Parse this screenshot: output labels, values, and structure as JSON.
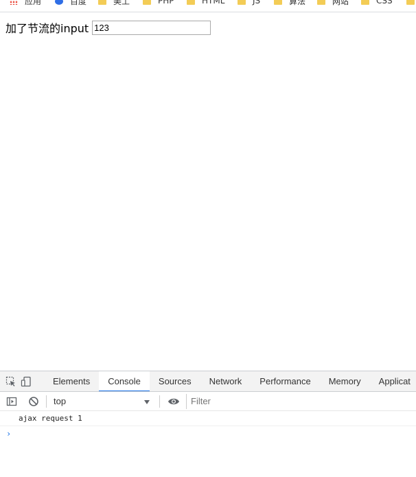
{
  "bookmarks": [
    {
      "label": "应用",
      "icon": "apps-icon"
    },
    {
      "label": "百度",
      "icon": "baidu-icon"
    },
    {
      "label": "美工",
      "icon": "folder-icon"
    },
    {
      "label": "PHP",
      "icon": "folder-icon"
    },
    {
      "label": "HTML",
      "icon": "folder-icon"
    },
    {
      "label": "JS",
      "icon": "folder-icon"
    },
    {
      "label": "算法",
      "icon": "folder-icon"
    },
    {
      "label": "网站",
      "icon": "folder-icon"
    },
    {
      "label": "CSS",
      "icon": "folder-icon"
    }
  ],
  "page": {
    "label": "加了节流的input",
    "input_value": "123"
  },
  "devtools": {
    "tabs": [
      "Elements",
      "Console",
      "Sources",
      "Network",
      "Performance",
      "Memory",
      "Applicat"
    ],
    "active_tab": "Console",
    "context": "top",
    "filter_placeholder": "Filter",
    "messages": [
      "ajax request 1"
    ],
    "prompt": "›",
    "accent": "#1a73e8"
  }
}
